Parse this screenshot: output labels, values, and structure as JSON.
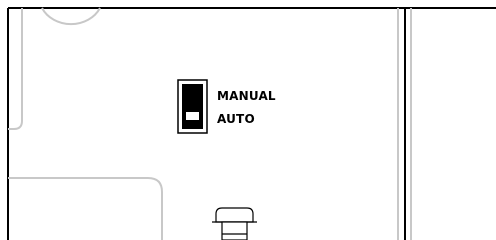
{
  "switch": {
    "positions": [
      "MANUAL",
      "AUTO"
    ],
    "selected": "AUTO"
  },
  "colors": {
    "line": "#000000",
    "light_line": "#bdbdbd",
    "panel_line": "#c8c8c8",
    "background": "#ffffff"
  }
}
